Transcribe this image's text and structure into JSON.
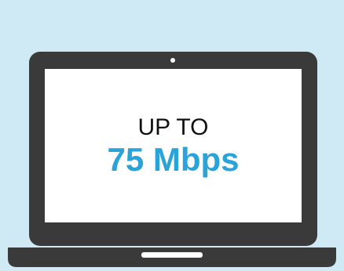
{
  "laptop": {
    "line1": "UP TO",
    "line2": "75 Mbps"
  },
  "colors": {
    "background": "#cfeaf4",
    "laptop_frame": "#3a3a3a",
    "screen": "#ffffff",
    "accent": "#2aa3d8",
    "text": "#111111"
  },
  "icons": [
    "laptop-icon",
    "webcam-dot-icon"
  ]
}
